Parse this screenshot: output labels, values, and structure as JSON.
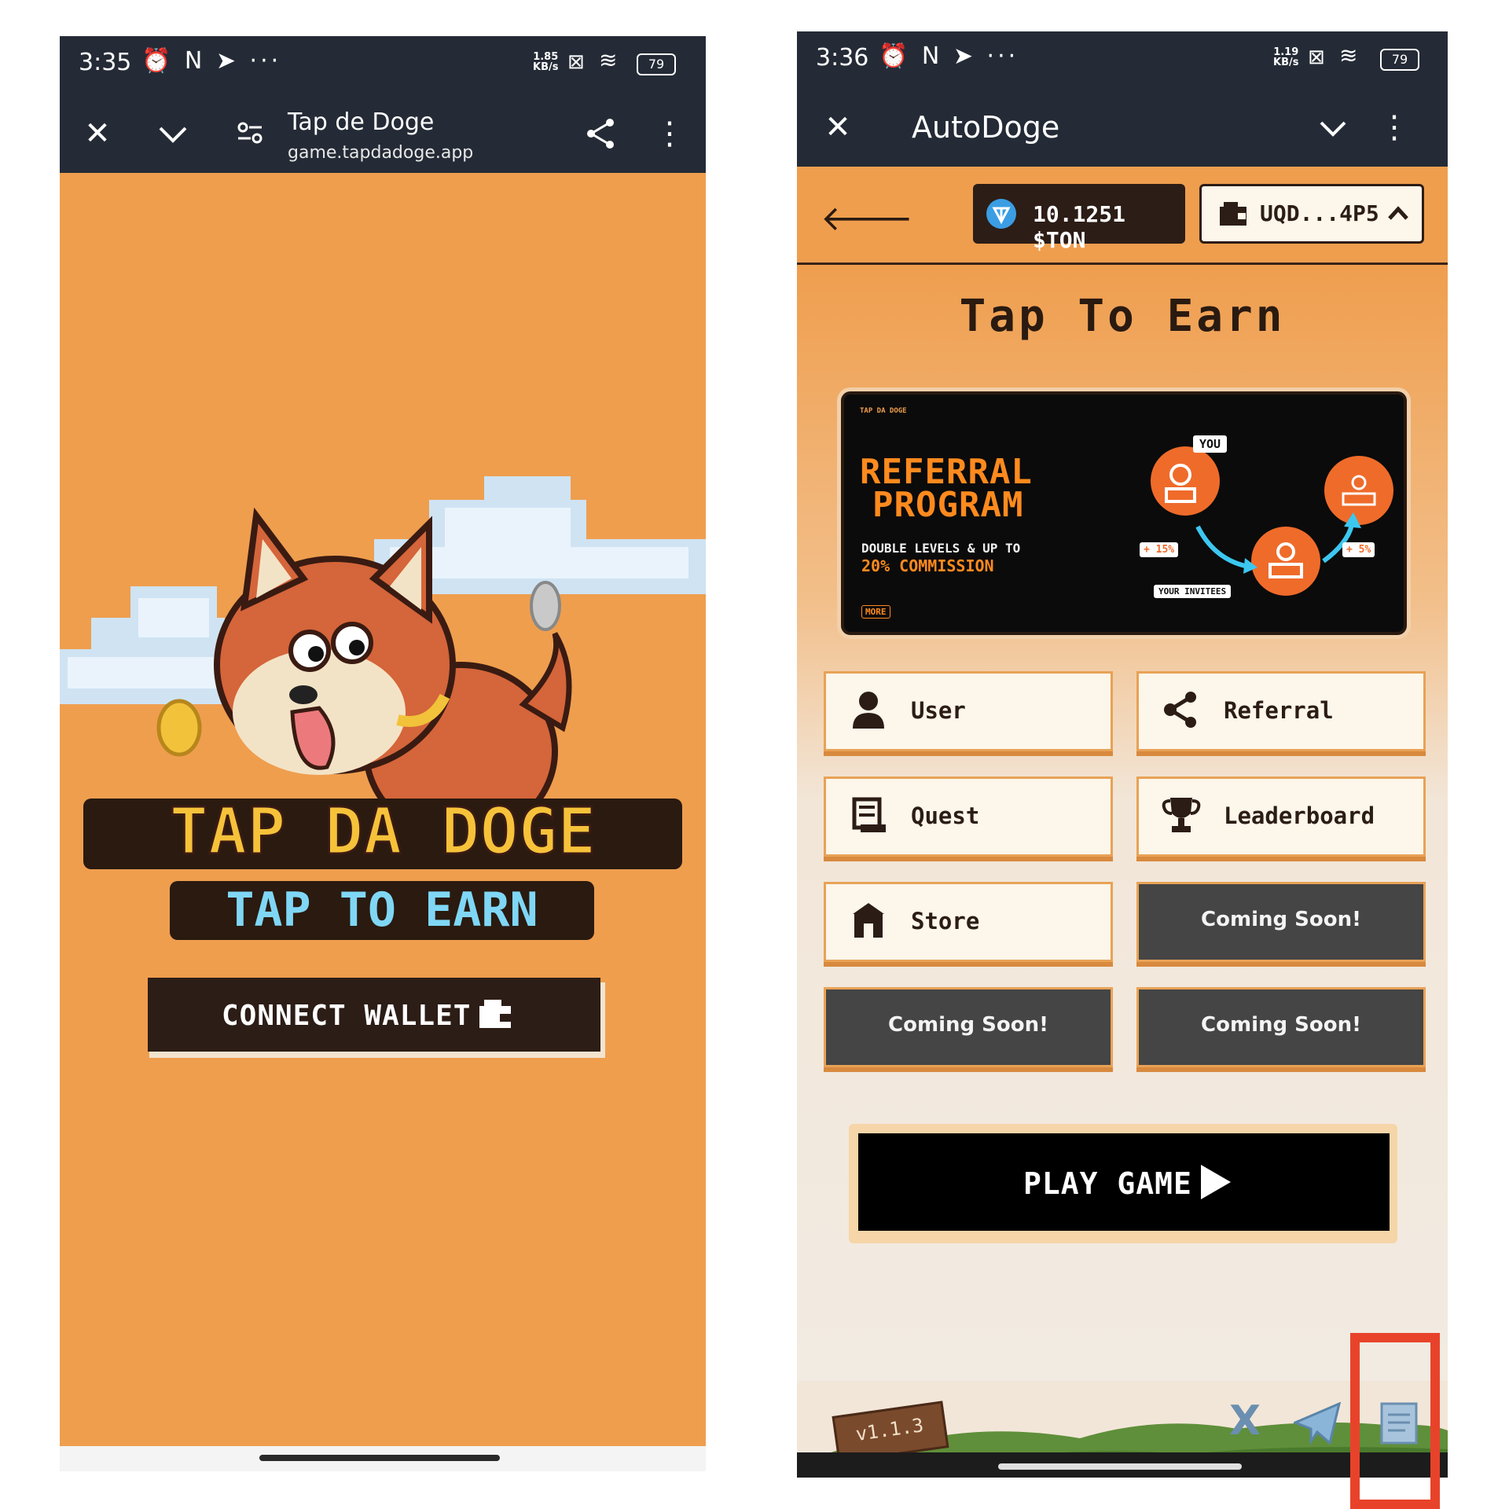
{
  "left_phone": {
    "status": {
      "time": "3:35",
      "net_speed": "1.85",
      "net_unit": "KB/s",
      "battery": "79"
    },
    "toolbar": {
      "title": "Tap de Doge",
      "url": "game.tapdadoge.app"
    },
    "logo": {
      "title": "TAP DA DOGE",
      "subtitle": "TAP TO EARN"
    },
    "connect_button": "CONNECT WALLET"
  },
  "right_phone": {
    "status": {
      "time": "3:36",
      "net_speed": "1.19",
      "net_unit": "KB/s",
      "battery": "79"
    },
    "toolbar": {
      "title": "AutoDoge"
    },
    "header": {
      "balance": "10.1251 $TON",
      "wallet": "UQD...4P5"
    },
    "page_title": "Tap To Earn",
    "banner": {
      "brand": "TAP DA DOGE",
      "title_line1": "REFERRAL",
      "title_line2": "PROGRAM",
      "sub_line1": "DOUBLE LEVELS & UP TO",
      "sub_line2": "20% COMMISSION",
      "more": "MORE",
      "you": "YOU",
      "invitees": "YOUR INVITEES",
      "pct_left": "+ 15%",
      "pct_right": "+ 5%"
    },
    "menu": {
      "user": "User",
      "referral": "Referral",
      "quest": "Quest",
      "leaderboard": "Leaderboard",
      "store": "Store",
      "coming_soon_1": "Coming Soon!",
      "coming_soon_2": "Coming Soon!",
      "coming_soon_3": "Coming Soon!"
    },
    "play_button": "PLAY GAME",
    "version": "v1.1.3",
    "highlight_color": "#e8432a"
  }
}
